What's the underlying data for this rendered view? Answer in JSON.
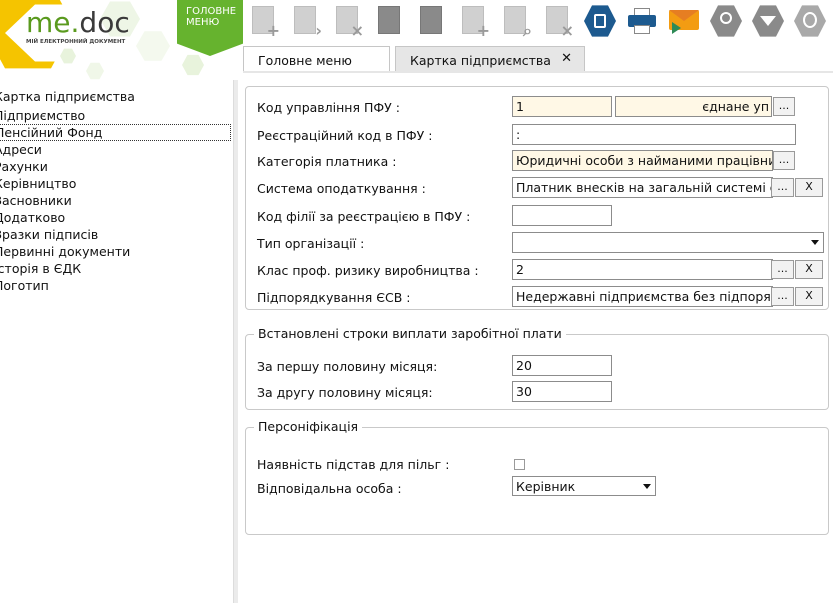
{
  "app": {
    "logo_me": "me",
    "logo_doc": "doc",
    "logo_subtitle": "МІЙ ЕЛЕКТРОННИЙ ДОКУМЕНТ",
    "main_menu_label_1": "ГОЛОВНЕ",
    "main_menu_label_2": "МЕНЮ"
  },
  "colors": {
    "brand_green": "#66b32e",
    "brand_yellow": "#f5c400",
    "required_field_bg": "#fff8e6"
  },
  "tabs": [
    {
      "label": "Головне меню",
      "closable": false
    },
    {
      "label": "Картка підприємства",
      "closable": true,
      "close_glyph": "✕"
    }
  ],
  "sidebar": {
    "items": [
      {
        "label": "Картка підприємства"
      },
      {
        "label": "Підприємство"
      },
      {
        "label": "Пенсійний Фонд",
        "selected": true
      },
      {
        "label": "Адреси"
      },
      {
        "label": "Рахунки"
      },
      {
        "label": "Керівництво"
      },
      {
        "label": "Засновники"
      },
      {
        "label": "Додатково"
      },
      {
        "label": "Зразки підписів"
      },
      {
        "label": "Первинні документи"
      },
      {
        "label": "Історія в ЄДК"
      },
      {
        "label": "Логотип"
      }
    ]
  },
  "pfu": {
    "code_label": "Код управління ПФУ :",
    "code_value": "1",
    "code_name_value": "єднане уп",
    "reg_code_label": "Реєстраційний код в ПФУ :",
    "reg_code_value": ":",
    "payer_category_label": "Категорія платника :",
    "payer_category_value": "Юридичні особи з найманими працівниками",
    "tax_system_label": "Система оподаткування :",
    "tax_system_value": "Платник внесків на загальній системі оп",
    "branch_code_label": "Код філії за реєстрацією в ПФУ :",
    "branch_code_value": "",
    "org_type_label": "Тип організації :",
    "org_type_value": "",
    "risk_class_label": "Клас проф. ризику виробництва :",
    "risk_class_value": "2",
    "esv_label": "Підпорядкування ЄСВ :",
    "esv_value": "Недержавні підприємства без підпоряд",
    "browse_btn": "...",
    "clear_btn": "X"
  },
  "salary": {
    "legend": "Встановлені строки виплати заробітної плати",
    "first_half_label": "За першу половину місяця:",
    "first_half_value": "20",
    "second_half_label": "За другу половину місяця:",
    "second_half_value": "30"
  },
  "personification": {
    "legend": "Персоніфікація",
    "benefits_label": "Наявність підстав для пільг :",
    "benefits_checked": false,
    "responsible_label": "Відповідальна особа :",
    "responsible_value": "Керівник"
  },
  "icons": [
    "new-doc-icon",
    "open-doc-icon",
    "delete-doc-icon",
    "copy-doc-icon",
    "edit-doc-icon",
    "add-list-icon",
    "search-doc-icon",
    "remove-list-icon",
    "save-icon",
    "print-icon",
    "send-mail-icon",
    "magnifier-icon",
    "filter-icon",
    "shield-check-icon"
  ]
}
